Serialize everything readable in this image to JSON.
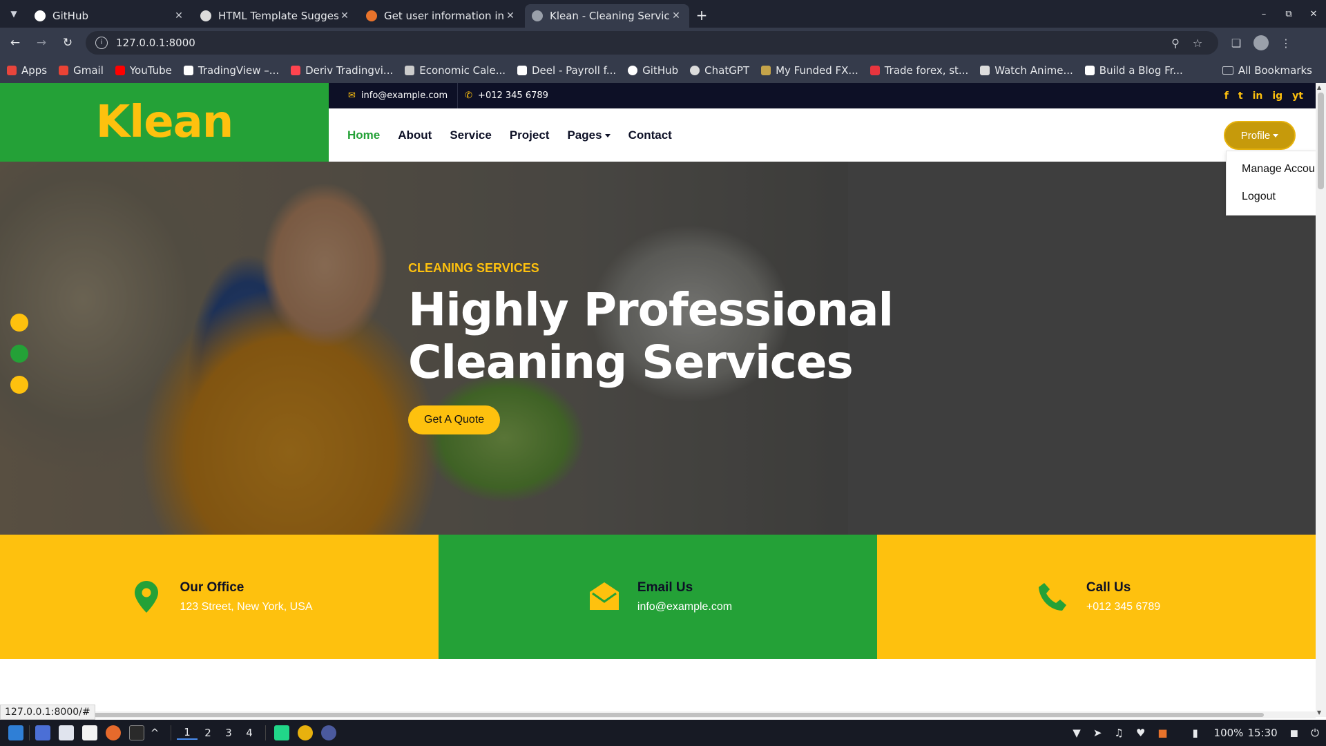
{
  "browser": {
    "tabs": [
      {
        "title": "GitHub",
        "fav_color": "#ffffff"
      },
      {
        "title": "HTML Template Suggesti",
        "fav_color": "#dcdcdc"
      },
      {
        "title": "Get user information in d",
        "fav_color": "#e8732b"
      },
      {
        "title": "Klean - Cleaning Services",
        "fav_color": "#9aa0aa",
        "active": true
      }
    ],
    "url": "127.0.0.1:8000",
    "bookmarks": [
      {
        "label": "Apps",
        "color": "#e8453c"
      },
      {
        "label": "Gmail",
        "color": "#ea4335"
      },
      {
        "label": "YouTube",
        "color": "#ff0000"
      },
      {
        "label": "TradingView –...",
        "color": "#ffffff"
      },
      {
        "label": "Deriv Tradingvi...",
        "color": "#ff444f"
      },
      {
        "label": "Economic Cale...",
        "color": "#cccccc"
      },
      {
        "label": "Deel - Payroll f...",
        "color": "#ffffff"
      },
      {
        "label": "GitHub",
        "color": "#ffffff"
      },
      {
        "label": "ChatGPT",
        "color": "#dcdcdc"
      },
      {
        "label": "My Funded FX...",
        "color": "#c5a44a"
      },
      {
        "label": "Trade forex, st...",
        "color": "#e8353e"
      },
      {
        "label": "Watch Anime...",
        "color": "#dcdcdc"
      },
      {
        "label": "Build a Blog Fr...",
        "color": "#ffffff"
      }
    ],
    "all_bookmarks": "All Bookmarks",
    "status_url": "127.0.0.1:8000/#"
  },
  "site": {
    "brand": "Klean",
    "topbar": {
      "email": "info@example.com",
      "phone": "+012 345 6789",
      "social": [
        "f",
        "t",
        "in",
        "ig",
        "yt"
      ]
    },
    "nav": [
      {
        "label": "Home",
        "active": true
      },
      {
        "label": "About"
      },
      {
        "label": "Service"
      },
      {
        "label": "Project"
      },
      {
        "label": "Pages",
        "dropdown": true
      },
      {
        "label": "Contact"
      }
    ],
    "profile": {
      "label": "Profile",
      "menu": [
        "Manage Accou",
        "Logout"
      ]
    },
    "hero": {
      "eyebrow": "CLEANING SERVICES",
      "headline": "Highly Professional Cleaning Services",
      "cta": "Get A Quote"
    },
    "features": [
      {
        "title": "Our Office",
        "text": "123 Street, New York, USA",
        "icon": "map-pin-icon"
      },
      {
        "title": "Email Us",
        "text": "info@example.com",
        "icon": "envelope-open-icon"
      },
      {
        "title": "Call Us",
        "text": "+012 345 6789",
        "icon": "phone-icon"
      }
    ]
  },
  "taskbar": {
    "workspaces": [
      "1",
      "2",
      "3",
      "4"
    ],
    "battery": "100%",
    "time": "15:30"
  },
  "colors": {
    "green": "#24a137",
    "yellow": "#fec10e",
    "navy": "#0d1026"
  }
}
